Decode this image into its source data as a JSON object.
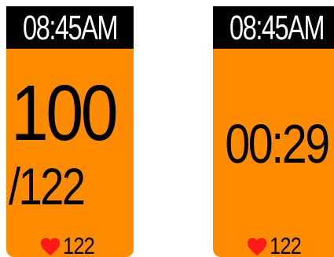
{
  "left_screen": {
    "time": "08:45AM",
    "current_hr": "100",
    "max_hr": "/122",
    "footer_hr": "122"
  },
  "right_screen": {
    "time": "08:45AM",
    "timer": "00:29",
    "footer_hr": "122"
  },
  "icons": {
    "heart": "heart-icon"
  },
  "colors": {
    "screen_background": "#ff8c00",
    "status_bar": "#000000",
    "heart": "#ff1a1a",
    "text_primary": "#000000",
    "text_status": "#ffffff"
  }
}
